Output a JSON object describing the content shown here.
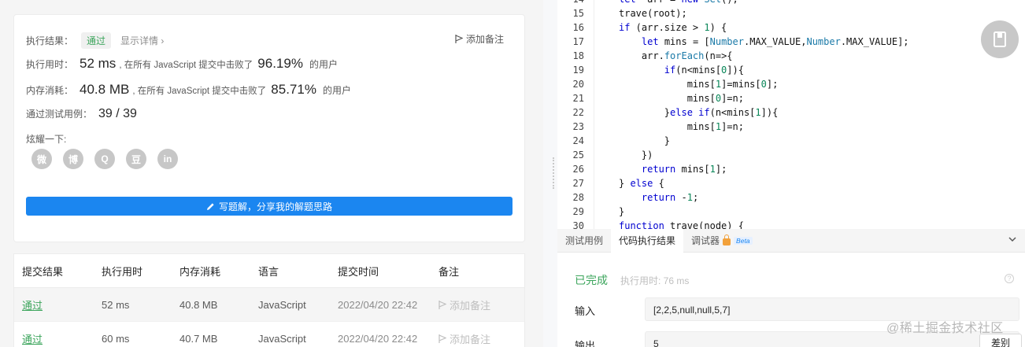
{
  "result_card": {
    "result_label": "执行结果：",
    "result_status": "通过",
    "show_detail": "显示详情 ›",
    "add_note": "添加备注",
    "runtime_label": "执行用时：",
    "runtime_value": "52 ms",
    "runtime_desc": ", 在所有 JavaScript 提交中击败了",
    "runtime_pct": "96.19%",
    "runtime_suffix": "的用户",
    "memory_label": "内存消耗：",
    "memory_value": "40.8 MB",
    "memory_desc": ", 在所有 JavaScript 提交中击败了",
    "memory_pct": "85.71%",
    "memory_suffix": "的用户",
    "cases_label": "通过测试用例：",
    "cases_value": "39 / 39",
    "share_label": "炫耀一下:",
    "share_icons": [
      "wechat-icon",
      "weibo-icon",
      "qq-icon",
      "douban-icon",
      "linkedin-icon"
    ],
    "share_glyphs": [
      "微",
      "博",
      "Q",
      "豆",
      "in"
    ],
    "write_solution": "写题解，分享我的解题思路"
  },
  "submissions": {
    "headers": [
      "提交结果",
      "执行用时",
      "内存消耗",
      "语言",
      "提交时间",
      "备注"
    ],
    "rows": [
      {
        "status": "通过",
        "runtime": "52 ms",
        "memory": "40.8 MB",
        "lang": "JavaScript",
        "time": "2022/04/20 22:42",
        "note": "添加备注"
      },
      {
        "status": "通过",
        "runtime": "60 ms",
        "memory": "40.7 MB",
        "lang": "JavaScript",
        "time": "2022/04/20 22:42",
        "note": "添加备注"
      }
    ]
  },
  "editor": {
    "lines": [
      {
        "n": "14",
        "indent": 1,
        "parts": [
          [
            "kw",
            "let"
          ],
          [
            "",
            "  arr = "
          ],
          [
            "kw",
            "new"
          ],
          [
            "bi",
            " Set"
          ],
          [
            "",
            "();"
          ]
        ]
      },
      {
        "n": "15",
        "indent": 1,
        "parts": [
          [
            "",
            "trave(root);"
          ]
        ]
      },
      {
        "n": "16",
        "indent": 1,
        "parts": [
          [
            "kw",
            "if"
          ],
          [
            "",
            " (arr.size > "
          ],
          [
            "nm",
            "1"
          ],
          [
            "",
            ") {"
          ]
        ]
      },
      {
        "n": "17",
        "indent": 2,
        "parts": [
          [
            "kw",
            "let"
          ],
          [
            "",
            " mins = ["
          ],
          [
            "bi",
            "Number"
          ],
          [
            "",
            ".MAX_VALUE,"
          ],
          [
            "bi",
            "Number"
          ],
          [
            "",
            ".MAX_VALUE];"
          ]
        ]
      },
      {
        "n": "18",
        "indent": 2,
        "parts": [
          [
            "",
            "arr."
          ],
          [
            "bi",
            "forEach"
          ],
          [
            "",
            "(n=>{"
          ]
        ]
      },
      {
        "n": "19",
        "indent": 3,
        "parts": [
          [
            "kw",
            "if"
          ],
          [
            "",
            "(n<mins["
          ],
          [
            "nm",
            "0"
          ],
          [
            "",
            "]){"
          ]
        ]
      },
      {
        "n": "20",
        "indent": 4,
        "parts": [
          [
            "",
            "mins["
          ],
          [
            "nm",
            "1"
          ],
          [
            "",
            "]=mins["
          ],
          [
            "nm",
            "0"
          ],
          [
            "",
            "];"
          ]
        ]
      },
      {
        "n": "21",
        "indent": 4,
        "parts": [
          [
            "",
            "mins["
          ],
          [
            "nm",
            "0"
          ],
          [
            "",
            "]=n;"
          ]
        ]
      },
      {
        "n": "22",
        "indent": 3,
        "parts": [
          [
            "",
            "}"
          ],
          [
            "kw",
            "else if"
          ],
          [
            "",
            "(n<mins["
          ],
          [
            "nm",
            "1"
          ],
          [
            "",
            "]){"
          ]
        ]
      },
      {
        "n": "23",
        "indent": 4,
        "parts": [
          [
            "",
            "mins["
          ],
          [
            "nm",
            "1"
          ],
          [
            "",
            "]=n;"
          ]
        ]
      },
      {
        "n": "24",
        "indent": 3,
        "parts": [
          [
            "",
            "}"
          ]
        ]
      },
      {
        "n": "25",
        "indent": 2,
        "parts": [
          [
            "",
            "})"
          ]
        ]
      },
      {
        "n": "26",
        "indent": 2,
        "parts": [
          [
            "kw",
            "return"
          ],
          [
            "",
            " mins["
          ],
          [
            "nm",
            "1"
          ],
          [
            "",
            "];"
          ]
        ]
      },
      {
        "n": "27",
        "indent": 1,
        "parts": [
          [
            "",
            "} "
          ],
          [
            "kw",
            "else"
          ],
          [
            "",
            " {"
          ]
        ]
      },
      {
        "n": "28",
        "indent": 2,
        "parts": [
          [
            "kw",
            "return"
          ],
          [
            "",
            " -"
          ],
          [
            "nm",
            "1"
          ],
          [
            "",
            ";"
          ]
        ]
      },
      {
        "n": "29",
        "indent": 1,
        "parts": [
          [
            "",
            "}"
          ]
        ]
      },
      {
        "n": "30",
        "indent": 1,
        "parts": [
          [
            "kw",
            "function"
          ],
          [
            "",
            " trave(node) {"
          ]
        ]
      }
    ]
  },
  "console": {
    "tabs": [
      "测试用例",
      "代码执行结果",
      "调试器"
    ],
    "beta": "Beta",
    "status": "已完成",
    "exec_time": "执行用时: 76 ms",
    "input_label": "输入",
    "input_value": "[2,2,5,null,null,5,7]",
    "output_label": "输出",
    "output_value": "5",
    "diff_button": "差别"
  },
  "watermark": "@稀土掘金技术社区"
}
